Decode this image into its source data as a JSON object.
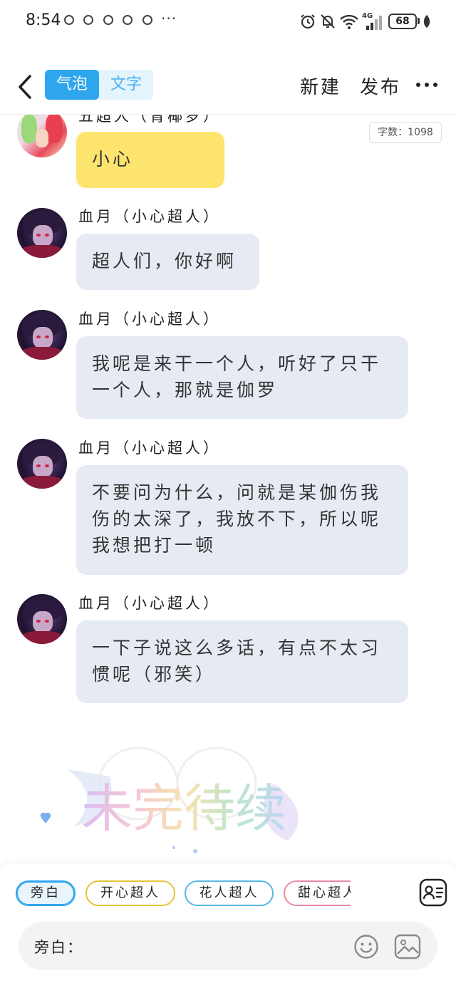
{
  "status_bar": {
    "time": "8:54",
    "more": "···",
    "network": "4G",
    "battery": "68"
  },
  "header": {
    "tab_bubble": "气泡",
    "tab_text": "文字",
    "new_label": "新建",
    "publish_label": "发布"
  },
  "chat": {
    "word_count": "字数：1098",
    "partial_sender": "五超人（青椰罗）",
    "messages": [
      {
        "sender": "",
        "text": "小心",
        "style": "yellow"
      },
      {
        "sender": "血月（小心超人）",
        "text": "超人们，你好啊"
      },
      {
        "sender": "血月（小心超人）",
        "text": "我呢是来干一个人，听好了只干一个人，那就是伽罗"
      },
      {
        "sender": "血月（小心超人）",
        "text": "不要问为什么，问就是某伽伤我伤的太深了，我放不下，所以呢我想把打一顿"
      },
      {
        "sender": "血月（小心超人）",
        "text": "一下子说这么多话，有点不太习惯呢（邪笑）"
      }
    ]
  },
  "bottom": {
    "chips": [
      "旁白",
      "开心超人",
      "花人超人",
      "甜心超人"
    ],
    "input_label": "旁白："
  },
  "colors": {
    "accent": "#2ea6ee",
    "bubble_gray": "#e6ebf3",
    "bubble_yellow": "#fde46e",
    "chip_active": "#2ea6ee",
    "chip_yellow": "#e6c43a",
    "chip_blue": "#58b8e6",
    "chip_pink": "#e98aa8"
  }
}
